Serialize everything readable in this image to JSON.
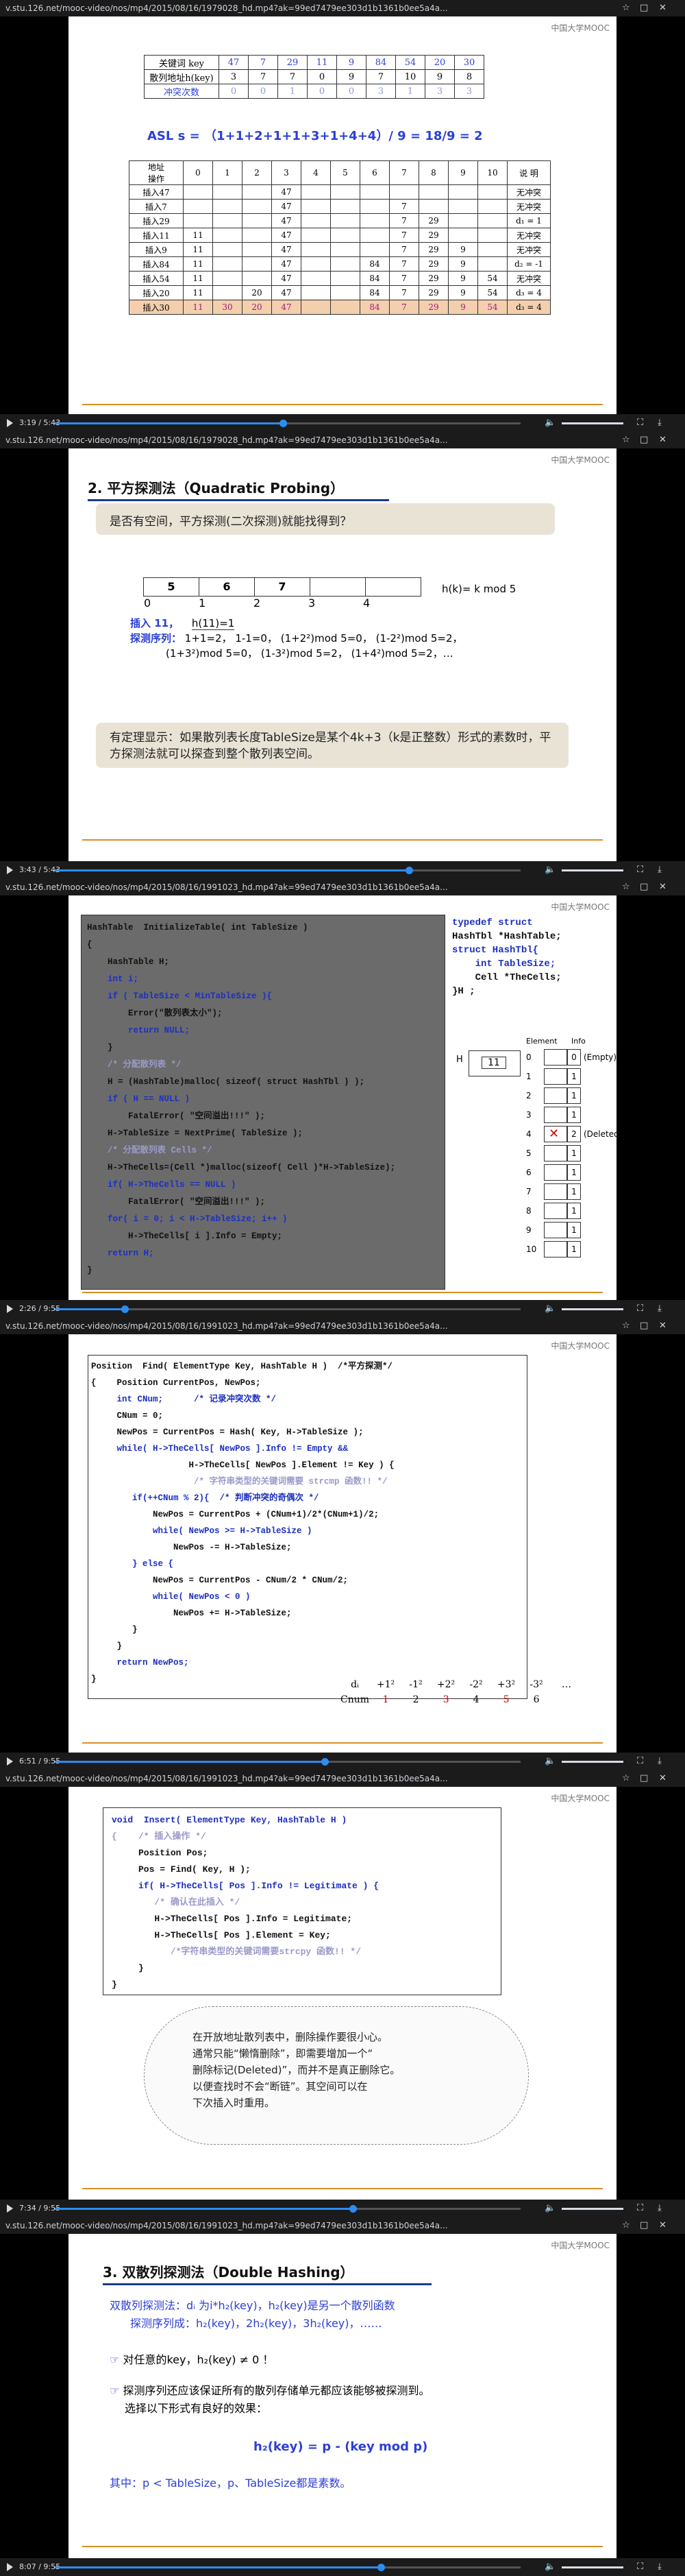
{
  "url": "v.stu.126.net/mooc-video/nos/mp4/2015/08/16/1979028_hd.mp4?ak=99ed7479ee303d1b1361b0ee5a4a...",
  "url2": "v.stu.126.net/mooc-video/nos/mp4/2015/08/16/1991023_hd.mp4?ak=99ed7479ee303d1b1361b0ee5a4a...",
  "logo": "中国大学MOOC",
  "frames": [
    {
      "time": "3:19 / 5:43",
      "progress": 0.49
    },
    {
      "time": "3:43 / 5:43",
      "progress": 0.76
    },
    {
      "time": "2:26 / 9:55",
      "progress": 0.15
    },
    {
      "time": "6:51 / 9:55",
      "progress": 0.58
    },
    {
      "time": "7:34 / 9:55",
      "progress": 0.64
    },
    {
      "time": "8:07 / 9:55",
      "progress": 0.7
    }
  ],
  "f1": {
    "row_labels": [
      "关键词 key",
      "散列地址h(key)",
      "冲突次数"
    ],
    "keys": [
      "47",
      "7",
      "29",
      "11",
      "9",
      "84",
      "54",
      "20",
      "30"
    ],
    "addrs": [
      "3",
      "7",
      "7",
      "0",
      "9",
      "7",
      "10",
      "9",
      "8"
    ],
    "conflicts": [
      "0",
      "0",
      "1",
      "0",
      "0",
      "3",
      "1",
      "3",
      "3"
    ],
    "asl": "ASL s = （1+1+2+1+1+3+1+4+4）/ 9 = 18/9 = 2",
    "corner_top": "地址",
    "corner_bottom": "操作",
    "cols": [
      "0",
      "1",
      "2",
      "3",
      "4",
      "5",
      "6",
      "7",
      "8",
      "9",
      "10"
    ],
    "desc_header": "说 明",
    "ops": [
      {
        "label": "插入47",
        "cells": [
          "",
          "",
          "",
          "47",
          "",
          "",
          "",
          "",
          "",
          "",
          ""
        ],
        "desc": "无冲突"
      },
      {
        "label": "插入7",
        "cells": [
          "",
          "",
          "",
          "47",
          "",
          "",
          "",
          "7",
          "",
          "",
          ""
        ],
        "desc": "无冲突"
      },
      {
        "label": "插入29",
        "cells": [
          "",
          "",
          "",
          "47",
          "",
          "",
          "",
          "7",
          "29",
          "",
          ""
        ],
        "desc": "d₁ = 1"
      },
      {
        "label": "插入11",
        "cells": [
          "11",
          "",
          "",
          "47",
          "",
          "",
          "",
          "7",
          "29",
          "",
          ""
        ],
        "desc": "无冲突"
      },
      {
        "label": "插入9",
        "cells": [
          "11",
          "",
          "",
          "47",
          "",
          "",
          "",
          "7",
          "29",
          "9",
          ""
        ],
        "desc": "无冲突"
      },
      {
        "label": "插入84",
        "cells": [
          "11",
          "",
          "",
          "47",
          "",
          "",
          "84",
          "7",
          "29",
          "9",
          ""
        ],
        "desc": "d₂ = -1"
      },
      {
        "label": "插入54",
        "cells": [
          "11",
          "",
          "",
          "47",
          "",
          "",
          "84",
          "7",
          "29",
          "9",
          "54"
        ],
        "desc": "无冲突"
      },
      {
        "label": "插入20",
        "cells": [
          "11",
          "",
          "20",
          "47",
          "",
          "",
          "84",
          "7",
          "29",
          "9",
          "54"
        ],
        "desc": "d₃ = 4"
      },
      {
        "label": "插入30",
        "cells": [
          "11",
          "30",
          "20",
          "47",
          "",
          "",
          "84",
          "7",
          "29",
          "9",
          "54"
        ],
        "desc": "d₃ = 4"
      }
    ]
  },
  "f2": {
    "title": "2. 平方探测法（Quadratic Probing）",
    "question": "是否有空间，平方探测(二次探测)就能找得到？",
    "cells": [
      "5",
      "6",
      "7",
      "",
      ""
    ],
    "idx": [
      "0",
      "1",
      "2",
      "3",
      "4"
    ],
    "hk": "h(k)= k mod 5",
    "insert": "插入 11，",
    "h11": "h(11)=1",
    "seq_label": "探测序列：",
    "seq1": "1+1=2，  1-1=0，   (1+2²)mod 5=0，  (1-2²)mod 5=2，",
    "seq2": "(1+3²)mod 5=0，  (1-3²)mod 5=2，   (1+4²)mod 5=2，…",
    "theorem": "有定理显示：如果散列表长度TableSize是某个4k+3（k是正整数）形式的素数时，平方探测法就可以探查到整个散列表空间。"
  },
  "f3": {
    "code": [
      "HashTable  InitializeTable( int TableSize )",
      "{",
      "    HashTable H;",
      "    int i;",
      "    if ( TableSize < MinTableSize ){",
      "        Error(\"散列表太小\");",
      "        return NULL;",
      "    }",
      "    /* 分配散列表 */",
      "    H = (HashTable)malloc( sizeof( struct HashTbl ) );",
      "    if ( H == NULL )",
      "        FatalError( \"空间溢出!!!\" );",
      "    H->TableSize = NextPrime( TableSize );",
      "    /* 分配散列表 Cells */",
      "    H->TheCells=(Cell *)malloc(sizeof( Cell )*H->TableSize);",
      "    if( H->TheCells == NULL )",
      "        FatalError( \"空间溢出!!!\" );",
      "    for( i = 0; i < H->TableSize; i++ )",
      "        H->TheCells[ i ].Info = Empty;",
      "    return H;",
      "}"
    ],
    "typedef": [
      "typedef struct",
      "HashTbl *HashTable;",
      "struct HashTbl{",
      "    int TableSize;",
      "    Cell *TheCells;",
      "}H ;"
    ],
    "h_label": "H",
    "h_size": "11",
    "element_header": "Element",
    "info_header": "Info",
    "rows": [
      "0",
      "1",
      "2",
      "3",
      "4",
      "5",
      "6",
      "7",
      "8",
      "9",
      "10"
    ],
    "info_vals": [
      "0",
      "1",
      "1",
      "1",
      "2",
      "1",
      "1",
      "1",
      "1",
      "1",
      "1"
    ],
    "row0_note": "(Empty)",
    "row4_note": "(Deleted"
  },
  "f4": {
    "code": [
      "Position  Find( ElementType Key, HashTable H )  /*平方探测*/",
      "{    Position CurrentPos, NewPos;",
      "     int CNum;      /* 记录冲突次数 */",
      "     CNum = 0;",
      "     NewPos = CurrentPos = Hash( Key, H->TableSize );",
      "     while( H->TheCells[ NewPos ].Info != Empty &&",
      "                   H->TheCells[ NewPos ].Element != Key ) {",
      "                    /* 字符串类型的关键词需要 strcmp 函数!! */",
      "        if(++CNum % 2){  /* 判断冲突的奇偶次 */",
      "            NewPos = CurrentPos + (CNum+1)/2*(CNum+1)/2;",
      "            while( NewPos >= H->TableSize )",
      "                NewPos -= H->TableSize;",
      "        } else {",
      "            NewPos = CurrentPos - CNum/2 * CNum/2;",
      "            while( NewPos < 0 )",
      "                NewPos += H->TableSize;",
      "        }",
      "     }",
      "     return NewPos;",
      "}"
    ],
    "d_row": [
      "dᵢ",
      "+1²",
      "-1²",
      "+2²",
      "-2²",
      "+3²",
      "-3²",
      "…"
    ],
    "c_row": [
      "Cnum",
      "1",
      "2",
      "3",
      "4",
      "5",
      "6"
    ]
  },
  "f5": {
    "code": [
      "void  Insert( ElementType Key, HashTable H )",
      "{    /* 插入操作 */",
      "     Position Pos;",
      "     Pos = Find( Key, H );",
      "     if( H->TheCells[ Pos ].Info != Legitimate ) {",
      "        /* 确认在此插入 */",
      "        H->TheCells[ Pos ].Info = Legitimate;",
      "        H->TheCells[ Pos ].Element = Key;",
      "           /*字符串类型的关键词需要strcpy 函数!! */",
      "     }",
      "}"
    ],
    "cloud": [
      "在开放地址散列表中，删除操作要很小心。",
      "通常只能“懒惰删除”，即需要增加一个“",
      "删除标记(Deleted)”，而并不是真正删除它。",
      "以便查找时不会“断链”。其空间可以在",
      "下次插入时重用。"
    ]
  },
  "f6": {
    "title": "3. 双散列探测法（Double Hashing）",
    "line1": "双散列探测法：dᵢ 为i*h₂(key)，h₂(key)是另一个散列函数",
    "line2": "探测序列成：h₂(key)，2h₂(key)，3h₂(key)，……",
    "bullet1": "对任意的key，h₂(key) ≠ 0 ！",
    "bullet2a": "探测序列还应该保证所有的散列存储单元都应该能够被探测到。",
    "bullet2b": "选择以下形式有良好的效果：",
    "formula": "h₂(key) = p - (key mod p)",
    "note": "其中：p < TableSize，p、TableSize都是素数。"
  }
}
